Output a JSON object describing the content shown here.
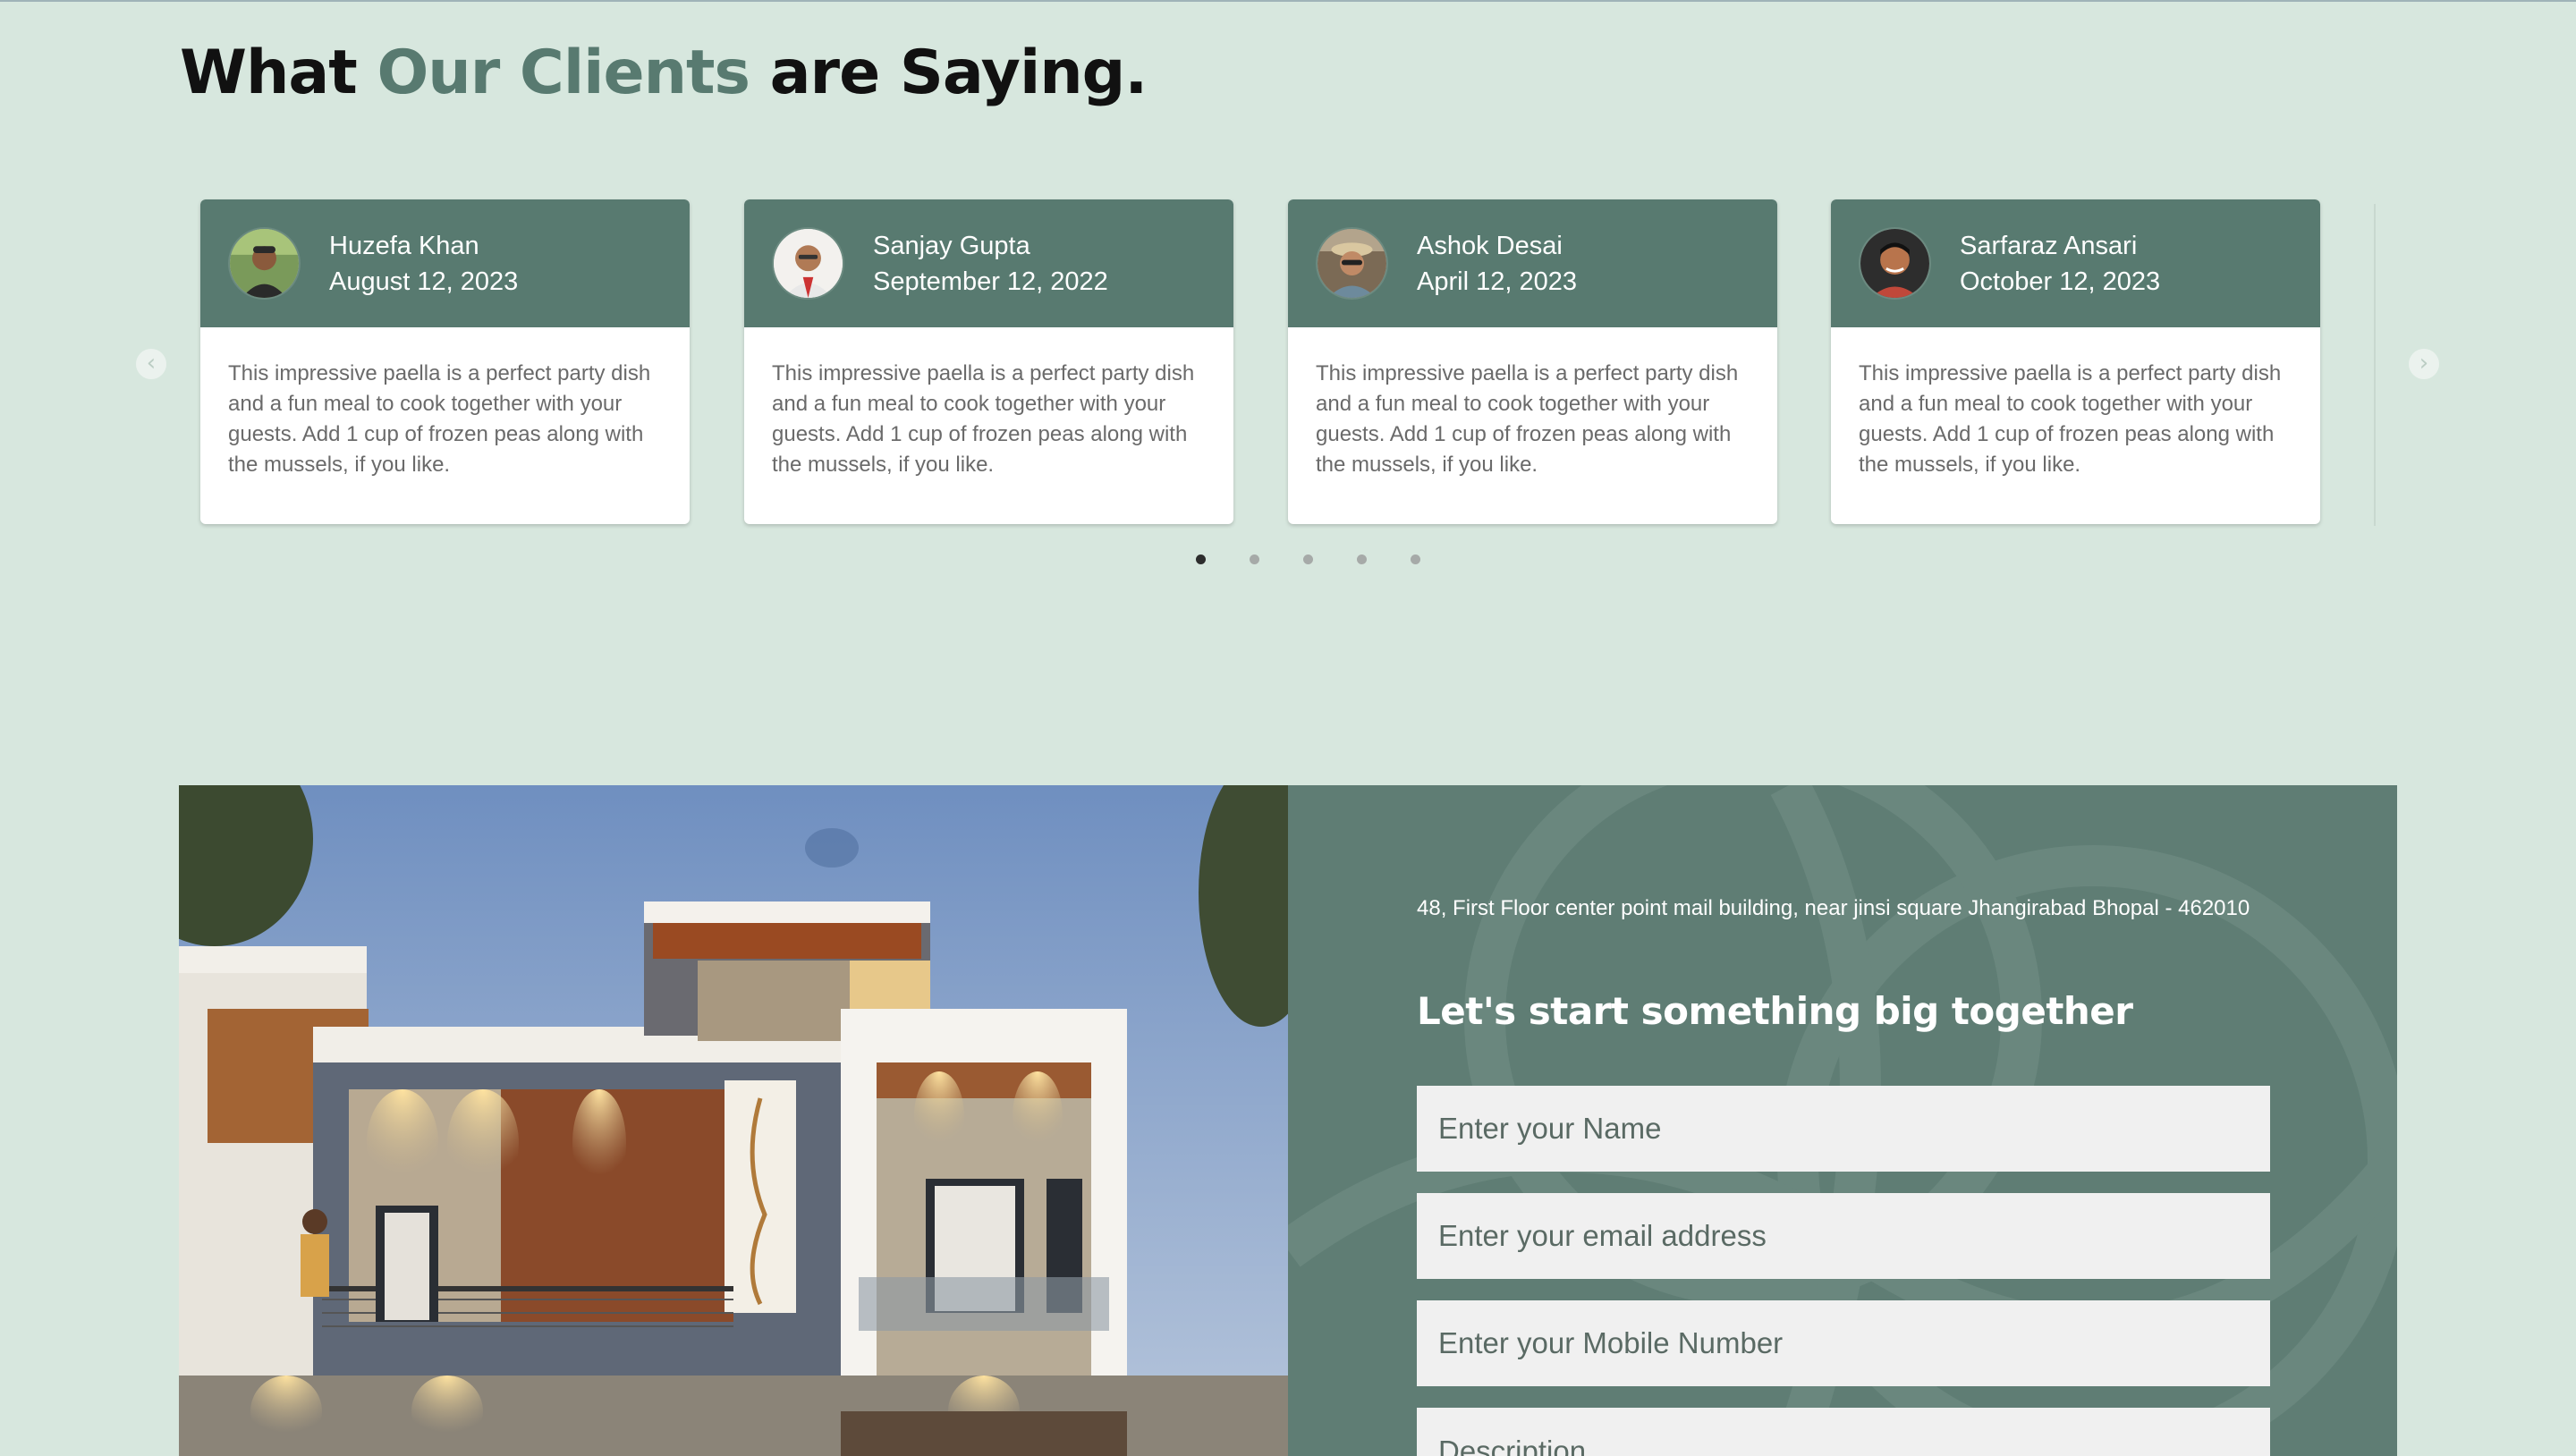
{
  "testimonials": {
    "heading_part1": "What",
    "heading_accent": "Our Clients",
    "heading_part2": "are Saying.",
    "cards": [
      {
        "name": "Huzefa Khan",
        "date": "August 12, 2023",
        "text": "This impressive paella is a perfect party dish and a fun meal to cook together with your guests. Add 1 cup of frozen peas along with the mussels, if you like."
      },
      {
        "name": "Sanjay Gupta",
        "date": "September 12, 2022",
        "text": "This impressive paella is a perfect party dish and a fun meal to cook together with your guests. Add 1 cup of frozen peas along with the mussels, if you like."
      },
      {
        "name": "Ashok Desai",
        "date": "April 12, 2023",
        "text": "This impressive paella is a perfect party dish and a fun meal to cook together with your guests. Add 1 cup of frozen peas along with the mussels, if you like."
      },
      {
        "name": "Sarfaraz Ansari",
        "date": "October 12, 2023",
        "text": "This impressive paella is a perfect party dish and a fun meal to cook together with your guests. Add 1 cup of frozen peas along with the mussels, if you like."
      }
    ],
    "prev_icon": "chevron-left-icon",
    "next_icon": "chevron-right-icon",
    "page_count": 5,
    "active_page": 1
  },
  "contact": {
    "address": "48, First Floor center point mail building, near jinsi square Jhangirabad Bhopal - 462010",
    "tagline": "Let's start something big together",
    "name_placeholder": "Enter your Name",
    "email_placeholder": "Enter your email address",
    "mobile_placeholder": "Enter your Mobile Number",
    "description_placeholder": "Description"
  },
  "colors": {
    "page_bg": "#d7e7de",
    "accent": "#587a70",
    "panel_bg": "#5f7d74",
    "field_bg": "#f0f0f0"
  }
}
